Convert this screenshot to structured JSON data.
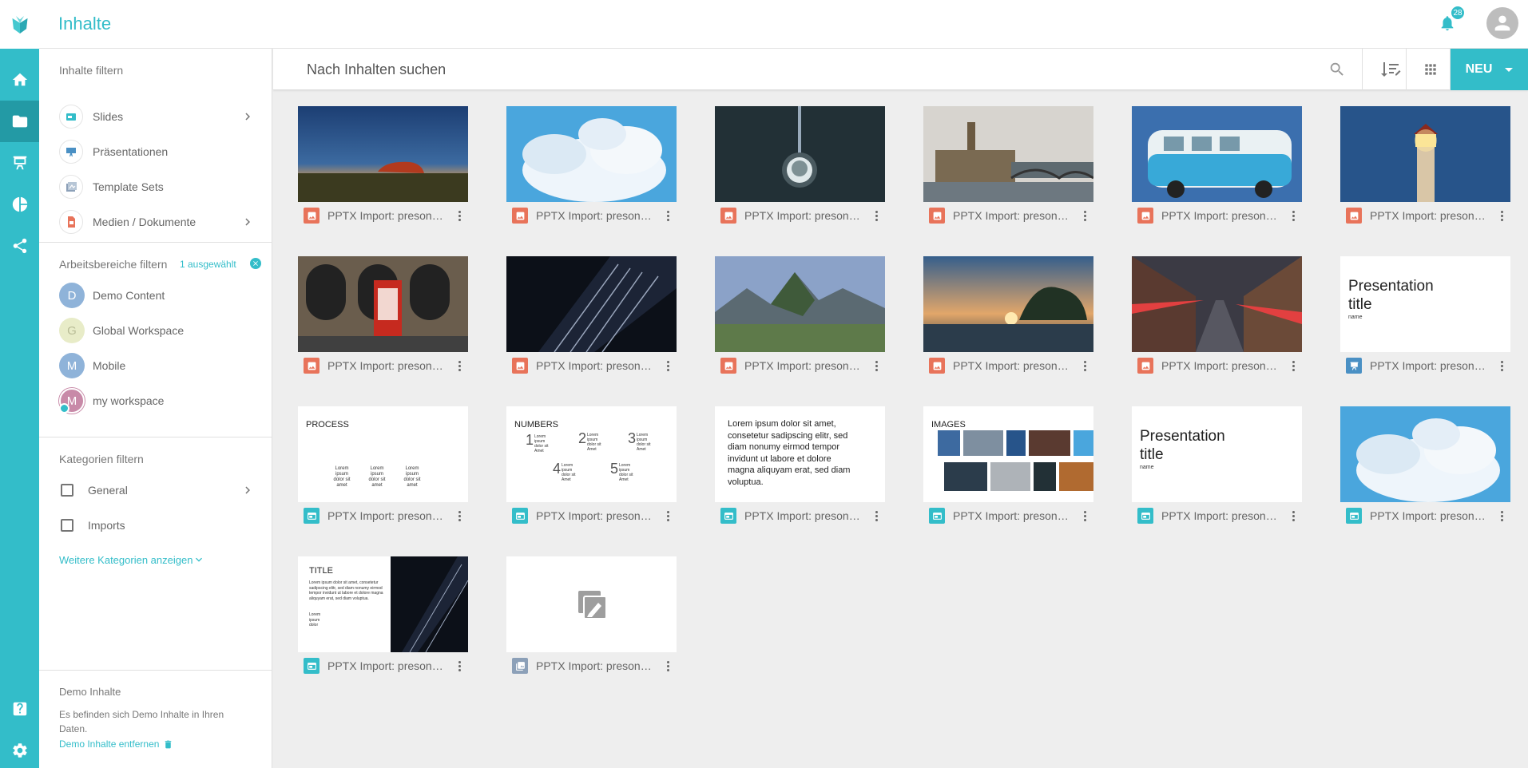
{
  "header": {
    "title": "Inhalte",
    "notification_count": "28"
  },
  "rail": {
    "items": [
      {
        "name": "home",
        "icon": "home-icon"
      },
      {
        "name": "folder",
        "icon": "folder-icon",
        "active": true
      },
      {
        "name": "presentation",
        "icon": "presenter-icon"
      },
      {
        "name": "analytics",
        "icon": "pie-chart-icon"
      },
      {
        "name": "share",
        "icon": "share-icon"
      }
    ],
    "bottom": [
      {
        "name": "help",
        "icon": "help-icon"
      },
      {
        "name": "settings",
        "icon": "gear-icon"
      }
    ]
  },
  "sidebar": {
    "content_filter_title": "Inhalte filtern",
    "content_filters": [
      {
        "label": "Slides",
        "icon": "slide-icon",
        "has_children": true
      },
      {
        "label": "Präsentationen",
        "icon": "presenter-icon",
        "has_children": false
      },
      {
        "label": "Template Sets",
        "icon": "template-icon",
        "has_children": false
      },
      {
        "label": "Medien / Dokumente",
        "icon": "media-icon",
        "has_children": true
      }
    ],
    "workspace_filter_title": "Arbeitsbereiche filtern",
    "workspace_selected": "1 ausgewählt",
    "workspaces": [
      {
        "letter": "D",
        "label": "Demo Content",
        "color": "#8fb3d9"
      },
      {
        "letter": "G",
        "label": "Global Workspace",
        "color": "#e8ecc8"
      },
      {
        "letter": "M",
        "label": "Mobile",
        "color": "#8fb3d9"
      },
      {
        "letter": "M",
        "label": "my workspace",
        "color": "#c88aa8",
        "selected": true
      }
    ],
    "category_filter_title": "Kategorien filtern",
    "categories": [
      {
        "label": "General",
        "has_children": true
      },
      {
        "label": "Imports",
        "has_children": false
      }
    ],
    "more_categories": "Weitere Kategorien anzeigen",
    "demo": {
      "title": "Demo Inhalte",
      "text": "Es befinden sich Demo Inhalte in Ihren Daten.",
      "remove_link": "Demo Inhalte entfernen"
    }
  },
  "search": {
    "placeholder": "Nach Inhalten suchen"
  },
  "toolbar": {
    "new_label": "NEU"
  },
  "colors": {
    "accent": "#33bdc9",
    "media": "#e8735a",
    "slide": "#33bdc9"
  },
  "cards": [
    {
      "caption": "PPTX Import: presono...",
      "type": "media",
      "thumb": "uluru"
    },
    {
      "caption": "PPTX Import: presono...",
      "type": "media",
      "thumb": "clouds"
    },
    {
      "caption": "PPTX Import: presono...",
      "type": "media",
      "thumb": "tower"
    },
    {
      "caption": "PPTX Import: presono...",
      "type": "media",
      "thumb": "london"
    },
    {
      "caption": "PPTX Import: presono...",
      "type": "media",
      "thumb": "vwbus"
    },
    {
      "caption": "PPTX Import: presono...",
      "type": "media",
      "thumb": "lighthouse"
    },
    {
      "caption": "PPTX Import: presono...",
      "type": "media",
      "thumb": "phonebox"
    },
    {
      "caption": "PPTX Import: presono...",
      "type": "media",
      "thumb": "building"
    },
    {
      "caption": "PPTX Import: presono...",
      "type": "media",
      "thumb": "machupicchu"
    },
    {
      "caption": "PPTX Import: presono...",
      "type": "media",
      "thumb": "temple"
    },
    {
      "caption": "PPTX Import: presono...",
      "type": "media",
      "thumb": "street"
    },
    {
      "caption": "PPTX Import: presono...",
      "type": "presentation",
      "thumb": "title",
      "slide_title": "Presentation title",
      "slide_sub": "name"
    },
    {
      "caption": "PPTX Import: presono...",
      "type": "slide",
      "thumb": "process",
      "slide_title": "PROCESS",
      "slide_sub": "Lorem ipsum dolor sit amet"
    },
    {
      "caption": "PPTX Import: presono...",
      "type": "slide",
      "thumb": "numbers",
      "slide_title": "NUMBERS",
      "slide_sub": "Lorem ipsum dolor sit Amet"
    },
    {
      "caption": "PPTX Import: presono...",
      "type": "slide",
      "thumb": "text",
      "slide_title": "Lorem ipsum dolor sit amet, consetetur sadipscing elitr, sed diam nonumy eirmod tempor invidunt ut labore et dolore magna aliquyam erat, sed diam voluptua."
    },
    {
      "caption": "PPTX Import: presono...",
      "type": "slide",
      "thumb": "images",
      "slide_title": "IMAGES"
    },
    {
      "caption": "PPTX Import: presono...",
      "type": "slide",
      "thumb": "title",
      "slide_title": "Presentation title",
      "slide_sub": "name"
    },
    {
      "caption": "PPTX Import: presono...",
      "type": "slide",
      "thumb": "clouds"
    },
    {
      "caption": "PPTX Import: presono...",
      "type": "slide",
      "thumb": "titleimg",
      "slide_title": "TITLE",
      "slide_sub": "Lorem ipsum dolor sit amet, consetetur sadipscing elitr, sed diam nonumy eirmod tempor invidunt ut labore et dolore magna aliquyam erat, sed diam voluptua.",
      "slide_sub2": "Lorem ipsum dolor"
    },
    {
      "caption": "PPTX Import: presono...",
      "type": "template",
      "thumb": "placeholder"
    }
  ]
}
